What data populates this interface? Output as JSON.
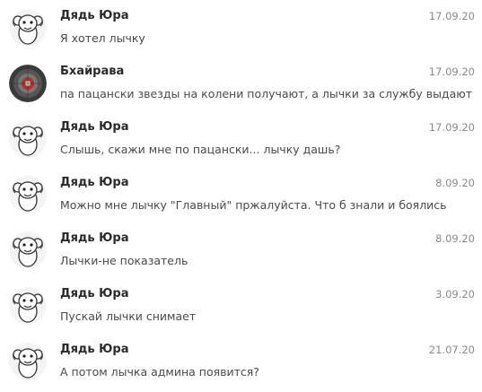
{
  "messages": [
    {
      "author": "Дядь Юра",
      "date": "17.09.20",
      "text": "Я хотел лычку",
      "avatar": "sticker-sheep-icon"
    },
    {
      "author": "Бхайрава",
      "date": "17.09.20",
      "text": "па пацански звезды на колени получают, а  лычки за службу выдают",
      "avatar": "dark-photo-avatar"
    },
    {
      "author": "Дядь Юра",
      "date": "17.09.20",
      "text": "Слышь, скажи мне по пацански... лычку дашь?",
      "avatar": "sticker-sheep-icon"
    },
    {
      "author": "Дядь Юра",
      "date": "8.09.20",
      "text": "Можно мне лычку \"Главный\" пржалуйста. Что б знали и боялись",
      "avatar": "sticker-sheep-icon"
    },
    {
      "author": "Дядь Юра",
      "date": "8.09.20",
      "text": "Лычки-не показатель",
      "avatar": "sticker-sheep-icon"
    },
    {
      "author": "Дядь Юра",
      "date": "3.09.20",
      "text": "Пускай лычки снимает",
      "avatar": "sticker-sheep-icon"
    },
    {
      "author": "Дядь Юра",
      "date": "21.07.20",
      "text": "А потом лычка админа появится?",
      "avatar": "sticker-sheep-icon"
    }
  ]
}
